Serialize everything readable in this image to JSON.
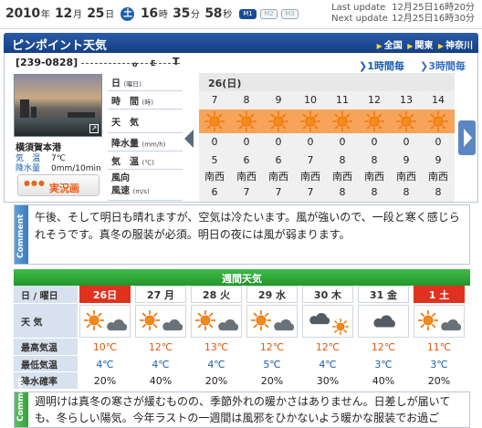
{
  "topbar": {
    "year": "2010",
    "year_unit": "年",
    "month": "12",
    "month_unit": "月",
    "day": "25",
    "day_unit": "日",
    "weekday": "土",
    "hour": "16",
    "hour_unit": "時",
    "minute": "35",
    "minute_unit": "分",
    "second": "58",
    "second_unit": "秒",
    "modes": [
      "M1",
      "M2",
      "M3"
    ],
    "last_update_label": "Last update",
    "last_update_value": "12月25日16時20分",
    "next_update_label": "Next update",
    "next_update_value": "12月25日16時30分"
  },
  "header": {
    "title": "ピンポイント天気",
    "breadcrumbs": [
      "全国",
      "関東",
      "神奈川"
    ]
  },
  "point": {
    "postal_code": "[239-0828]",
    "location_label": "o",
    "location_code": "E",
    "end_mark": "T",
    "interval_1h": "1時間毎",
    "interval_3h": "3時間毎",
    "camera": {
      "name": "横須賀本港",
      "temp_label": "気　温",
      "temp_value": "7℃",
      "precip_label": "降水量",
      "precip_value": "0mm/10min",
      "live_button": "実況画"
    },
    "row_labels": [
      {
        "main": "日",
        "sub": "(曜日)"
      },
      {
        "main": "時　間",
        "sub": "(時)"
      },
      {
        "main": "天　気",
        "sub": ""
      },
      {
        "main": "降水量",
        "sub": "(mm/h)"
      },
      {
        "main": "気　温",
        "sub": "(℃)"
      },
      {
        "main": "風向",
        "sub": ""
      },
      {
        "main": "風速",
        "sub": "(m/s)"
      }
    ],
    "day_label": "26(日)",
    "hours": [
      "7",
      "8",
      "9",
      "10",
      "11",
      "12",
      "13",
      "14"
    ],
    "weather_icons": [
      "sun-icon",
      "sun-icon",
      "sun-icon",
      "sun-icon",
      "sun-icon",
      "sun-icon",
      "sun-icon",
      "sun-icon"
    ],
    "precip": [
      "0",
      "0",
      "0",
      "0",
      "0",
      "0",
      "0",
      "0"
    ],
    "temp": [
      "5",
      "6",
      "6",
      "7",
      "8",
      "8",
      "9",
      "9"
    ],
    "wind_dir": [
      "南西",
      "南西",
      "南西",
      "南西",
      "南西",
      "南西",
      "南西",
      "南西"
    ],
    "wind_speed": [
      "6",
      "7",
      "7",
      "7",
      "8",
      "8",
      "8",
      "8"
    ]
  },
  "comment1": {
    "tag": "Comment",
    "text": "午後、そして明日も晴れますが、空気は冷たいます。風が強いので、一段と寒く感じられそうです。真冬の服装が必須。明日の夜には風が弱まります。"
  },
  "weekly": {
    "title": "週間天気",
    "date_label": "日 / 曜日",
    "weather_label": "天 気",
    "hi_label": "最高気温",
    "lo_label": "最低気温",
    "rain_label": "降水確率",
    "days": [
      {
        "date": "26日",
        "dow": "",
        "hi": "10℃",
        "lo": "4℃",
        "rain": "20%",
        "icon": "sun-cloud-icon",
        "style": "today"
      },
      {
        "date": "27",
        "dow": "月",
        "hi": "12℃",
        "lo": "4℃",
        "rain": "40%",
        "icon": "sun-cloud-icon",
        "style": ""
      },
      {
        "date": "28",
        "dow": "火",
        "hi": "13℃",
        "lo": "4℃",
        "rain": "20%",
        "icon": "sun-cloud-icon",
        "style": ""
      },
      {
        "date": "29",
        "dow": "水",
        "hi": "12℃",
        "lo": "5℃",
        "rain": "20%",
        "icon": "sun-cloud-icon",
        "style": ""
      },
      {
        "date": "30",
        "dow": "木",
        "hi": "12℃",
        "lo": "4℃",
        "rain": "30%",
        "icon": "cloud-sun-icon",
        "style": ""
      },
      {
        "date": "31",
        "dow": "金",
        "hi": "12℃",
        "lo": "3℃",
        "rain": "40%",
        "icon": "cloud-icon",
        "style": ""
      },
      {
        "date": "1",
        "dow": "土",
        "hi": "11℃",
        "lo": "3℃",
        "rain": "20%",
        "icon": "sun-cloud-icon",
        "style": "sat"
      }
    ]
  },
  "comment2": {
    "tag": "Comment",
    "text": "週明けは真冬の寒さが緩むものの、季節外れの暖かさはありません。日差しが届いても、冬らしい陽気。今年ラストの一週間は風邪をひかないよう暖かな服装でお過ご"
  }
}
